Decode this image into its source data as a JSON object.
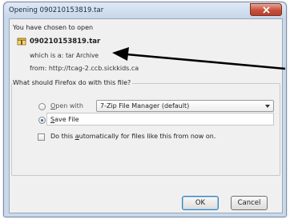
{
  "window": {
    "title": "Opening 090210153819.tar",
    "close_icon": "close-icon"
  },
  "dialog": {
    "intro": "You have chosen to open",
    "filename": "090210153819.tar",
    "file_icon": "archive-file-icon",
    "which_is_label": "which is a:",
    "which_is_value": "tar Archive",
    "from_label": "from:",
    "from_value": "http://tcag-2.ccb.sickkids.ca",
    "question": "What should Firefox do with this file?",
    "open_with": {
      "label_rest": "pen with",
      "label_key": "O",
      "checked": false,
      "app": "7-Zip File Manager (default)"
    },
    "save_file": {
      "label_key": "S",
      "label_rest": "ave File",
      "checked": true
    },
    "auto": {
      "label_pre": "Do this ",
      "label_key": "a",
      "label_rest": "utomatically for files like this from now on.",
      "checked": false
    },
    "buttons": {
      "ok": "OK",
      "cancel": "Cancel"
    }
  },
  "annotation": {
    "arrow_color": "#000000"
  }
}
